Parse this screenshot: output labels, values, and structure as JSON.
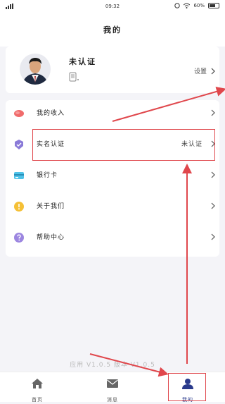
{
  "status_bar": {
    "time": "09:32",
    "battery": "60%"
  },
  "header": {
    "title": "我的"
  },
  "profile": {
    "name": "未认证",
    "settings_label": "设置"
  },
  "menu": {
    "items": [
      {
        "label": "我的收入",
        "value": "",
        "color": "#f06b6b"
      },
      {
        "label": "实名认证",
        "value": "未认证",
        "color": "#8a7ad8"
      },
      {
        "label": "银行卡",
        "value": "",
        "color": "#4ec2e8"
      },
      {
        "label": "关于我们",
        "value": "",
        "color": "#f5c036"
      },
      {
        "label": "帮助中心",
        "value": "",
        "color": "#9c86e0"
      }
    ]
  },
  "version_text": "应用 V1.0.5 版本 V1.0.5",
  "tabs": [
    {
      "label": "首页",
      "icon": "home-icon"
    },
    {
      "label": "消息",
      "icon": "mail-icon"
    },
    {
      "label": "我的",
      "icon": "user-icon"
    }
  ],
  "colors": {
    "accent": "#2a3a8c",
    "annotation": "#e0474c"
  }
}
